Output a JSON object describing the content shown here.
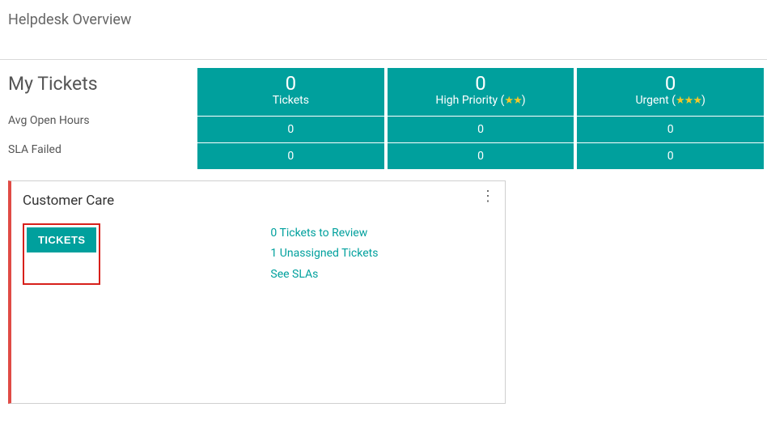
{
  "page_title": "Helpdesk Overview",
  "my_tickets_heading": "My Tickets",
  "row_labels": {
    "avg_open_hours": "Avg Open Hours",
    "sla_failed": "SLA Failed"
  },
  "stats": {
    "col1": {
      "big": "0",
      "title": "Tickets",
      "avg": "0",
      "sla": "0"
    },
    "col2": {
      "big": "0",
      "title_prefix": "High Priority (",
      "title_suffix": ")",
      "stars": "★★",
      "avg": "0",
      "sla": "0"
    },
    "col3": {
      "big": "0",
      "title_prefix": "Urgent (",
      "title_suffix": ")",
      "stars": "★★★",
      "avg": "0",
      "sla": "0"
    }
  },
  "team_card": {
    "title": "Customer Care",
    "button_label": "TICKETS",
    "links": {
      "to_review": "0 Tickets to Review",
      "unassigned": "1 Unassigned Tickets",
      "see_slas": "See SLAs"
    }
  }
}
